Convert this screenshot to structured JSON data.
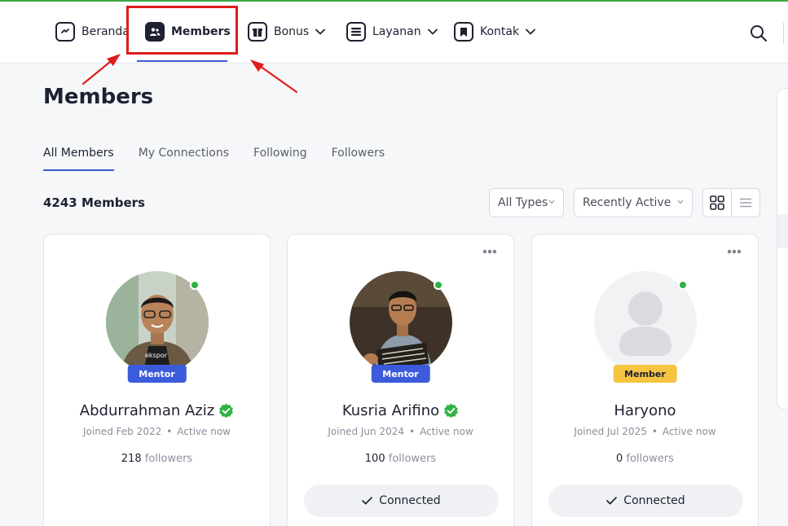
{
  "nav": {
    "items": [
      {
        "label": "Beranda",
        "icon": "home-icon"
      },
      {
        "label": "Members",
        "icon": "members-icon"
      },
      {
        "label": "Bonus",
        "icon": "gift-icon"
      },
      {
        "label": "Layanan",
        "icon": "services-icon"
      },
      {
        "label": "Kontak",
        "icon": "bookmark-icon"
      }
    ],
    "active": "Members"
  },
  "page": {
    "title": "Members",
    "tabs": [
      "All Members",
      "My Connections",
      "Following",
      "Followers"
    ],
    "active_tab": "All Members",
    "count": "4243 Members"
  },
  "filters": {
    "type": "All Types",
    "sort": "Recently Active"
  },
  "members": [
    {
      "name": "Abdurrahman Aziz",
      "role": "Mentor",
      "verified": true,
      "joined": "Joined Feb 2022",
      "active": "Active now",
      "followers_count": "218",
      "followers_label": "followers",
      "action": ""
    },
    {
      "name": "Kusria Arifino",
      "role": "Mentor",
      "verified": true,
      "joined": "Joined Jun 2024",
      "active": "Active now",
      "followers_count": "100",
      "followers_label": "followers",
      "action": "Connected"
    },
    {
      "name": "Haryono",
      "role": "Member",
      "verified": false,
      "joined": "Joined Jul 2025",
      "active": "Active now",
      "followers_count": "0",
      "followers_label": "followers",
      "action": "Connected"
    }
  ],
  "colors": {
    "accent": "#3b5bdb",
    "highlight": "#e01b1b",
    "online": "#2fb344",
    "mentor_badge": "#3b5bdb",
    "member_badge": "#f5c542",
    "verified": "#2fb344"
  }
}
